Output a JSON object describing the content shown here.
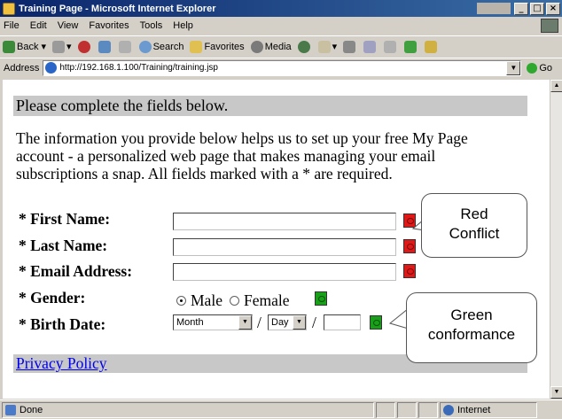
{
  "window": {
    "title": "Training Page - Microsoft Internet Explorer"
  },
  "menu": [
    "File",
    "Edit",
    "View",
    "Favorites",
    "Tools",
    "Help"
  ],
  "toolbar": {
    "back": "Back",
    "search": "Search",
    "favorites": "Favorites",
    "media": "Media"
  },
  "address": {
    "label": "Address",
    "url": "http://192.168.1.100/Training/training.jsp",
    "go": "Go"
  },
  "page": {
    "banner": "Please complete the fields below.",
    "intro": "The information you provide below helps us to set up your free My Page account - a personalized web page that makes managing your email subscriptions a snap. All fields marked with a * are required.",
    "fields": {
      "first_name": "* First Name:",
      "last_name": "* Last Name:",
      "email": "* Email Address:",
      "gender": "* Gender:",
      "birth_date": "* Birth Date:"
    },
    "gender": {
      "male": "Male",
      "female": "Female",
      "selected": "Male"
    },
    "birth": {
      "month": "Month",
      "day": "Day",
      "sep1": "/",
      "sep2": "/"
    },
    "privacy_link": "Privacy Policy"
  },
  "callouts": {
    "red_line1": "Red",
    "red_line2": "Conflict",
    "green_line1": "Green",
    "green_line2": "conformance"
  },
  "colors": {
    "conflict": "#e01818",
    "conformance": "#18a018"
  },
  "status": {
    "left": "Done",
    "zone": "Internet"
  }
}
